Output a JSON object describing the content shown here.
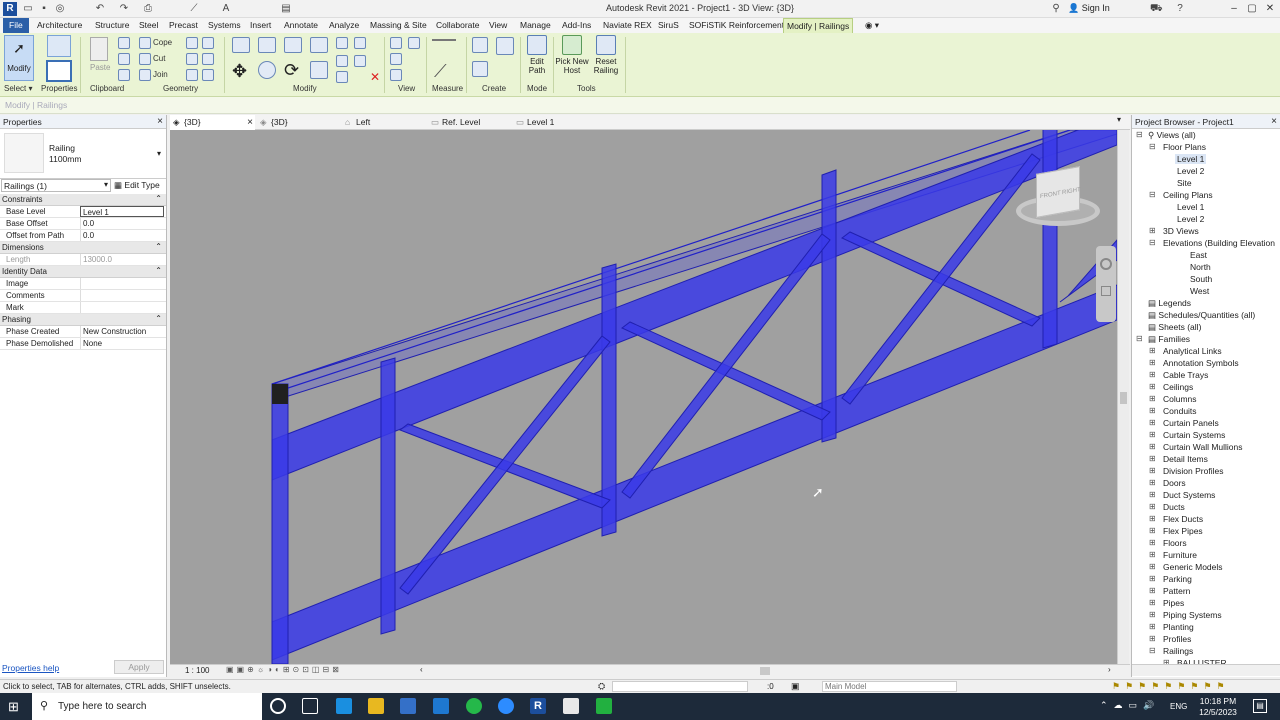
{
  "window": {
    "app_logo": "R",
    "title": "Autodesk Revit 2021 - Project1 - 3D View: {3D}",
    "sign_in": "Sign In",
    "minimize": "–",
    "maximize": "▢",
    "close": "✕"
  },
  "tabs": [
    "File",
    "Architecture",
    "Structure",
    "Steel",
    "Precast",
    "Systems",
    "Insert",
    "Annotate",
    "Analyze",
    "Massing & Site",
    "Collaborate",
    "View",
    "Manage",
    "Add-Ins",
    "Naviate REX",
    "SiruS",
    "SOFiSTiK Reinforcement",
    "Modify | Railings"
  ],
  "active_tab": "Modify | Railings",
  "ribbon": {
    "modify_label": "Modify",
    "paste_label": "Paste",
    "cope_label": "Cope",
    "cut_label": "Cut",
    "join_label": "Join",
    "edit_path_label": "Edit Path",
    "pick_new_host_label": "Pick New Host",
    "reset_railing_label": "Reset Railing",
    "groups": {
      "select": "Select",
      "properties": "Properties",
      "clipboard": "Clipboard",
      "geometry": "Geometry",
      "modify": "Modify",
      "view": "View",
      "measure": "Measure",
      "create": "Create",
      "mode": "Mode",
      "tools": "Tools"
    }
  },
  "context_bar": "Modify | Railings",
  "properties": {
    "title": "Properties",
    "type_family": "Railing",
    "type_name": "1100mm",
    "instance_filter": "Railings (1)",
    "edit_type": "Edit Type",
    "groups": {
      "constraints": "Constraints",
      "dimensions": "Dimensions",
      "identity": "Identity Data",
      "phasing": "Phasing"
    },
    "rows": {
      "base_level": {
        "k": "Base Level",
        "v": "Level 1"
      },
      "base_offset": {
        "k": "Base Offset",
        "v": "0.0"
      },
      "offset_from_path": {
        "k": "Offset from Path",
        "v": "0.0"
      },
      "length": {
        "k": "Length",
        "v": "13000.0"
      },
      "image": {
        "k": "Image",
        "v": ""
      },
      "comments": {
        "k": "Comments",
        "v": ""
      },
      "mark": {
        "k": "Mark",
        "v": ""
      },
      "phase_created": {
        "k": "Phase Created",
        "v": "New Construction"
      },
      "phase_demolished": {
        "k": "Phase Demolished",
        "v": "None"
      }
    },
    "help_link": "Properties help",
    "apply": "Apply"
  },
  "view_tabs": [
    {
      "label": "{3D}",
      "active": true
    },
    {
      "label": "{3D}",
      "active": false
    },
    {
      "label": "Left",
      "active": false
    },
    {
      "label": "Ref. Level",
      "active": false
    },
    {
      "label": "Level 1",
      "active": false
    }
  ],
  "viewcube": {
    "front": "FRONT",
    "right": "RIGHT"
  },
  "view_scale": "1 : 100",
  "project_browser": {
    "title": "Project Browser - Project1",
    "items": {
      "views": "Views (all)",
      "floor_plans": "Floor Plans",
      "fp_level1": "Level 1",
      "fp_level2": "Level 2",
      "fp_site": "Site",
      "ceiling_plans": "Ceiling Plans",
      "cp_level1": "Level 1",
      "cp_level2": "Level 2",
      "views_3d": "3D Views",
      "elevations": "Elevations (Building Elevation",
      "east": "East",
      "north": "North",
      "south": "South",
      "west": "West",
      "legends": "Legends",
      "schedules": "Schedules/Quantities (all)",
      "sheets": "Sheets (all)",
      "families": "Families",
      "fam_list": [
        "Analytical Links",
        "Annotation Symbols",
        "Cable Trays",
        "Ceilings",
        "Columns",
        "Conduits",
        "Curtain Panels",
        "Curtain Systems",
        "Curtain Wall Mullions",
        "Detail Items",
        "Division Profiles",
        "Doors",
        "Duct Systems",
        "Ducts",
        "Flex Ducts",
        "Flex Pipes",
        "Floors",
        "Furniture",
        "Generic Models",
        "Parking",
        "Pattern",
        "Pipes",
        "Piping Systems",
        "Planting",
        "Profiles",
        "Railings"
      ],
      "baluster": "BALLUSTER"
    }
  },
  "status": {
    "text": "Click to select, TAB for alternates, CTRL adds, SHIFT unselects.",
    "zero": ":0",
    "main_model": "Main Model"
  },
  "taskbar": {
    "search_placeholder": "Type here to search",
    "lang": "ENG",
    "time": "10:18 PM",
    "date": "12/5/2023"
  },
  "colors": {
    "railing_blue": "#3a3ae8",
    "viewport_gray": "#a0a0a0",
    "ribbon_green": "#eaf4d4"
  }
}
